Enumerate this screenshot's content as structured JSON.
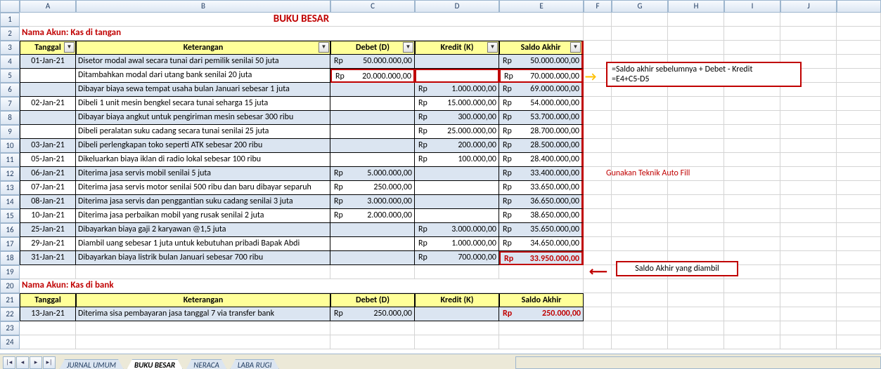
{
  "columns": [
    "A",
    "B",
    "C",
    "D",
    "E",
    "F",
    "G",
    "H",
    "I",
    "J"
  ],
  "title": "BUKU BESAR",
  "akun1": "Nama Akun: Kas di tangan",
  "akun2": "Nama Akun: Kas di bank",
  "headers": {
    "tanggal": "Tanggal",
    "keterangan": "Keterangan",
    "debet": "Debet (D)",
    "kredit": "Kredit (K)",
    "saldo": "Saldo Akhir"
  },
  "rows1": [
    {
      "r": 4,
      "tgl": "01-Jan-21",
      "ket": "Disetor modal awal secara tunai dari pemilik senilai 50 juta",
      "deb": "50.000.000,00",
      "kre": "",
      "sal": "50.000.000,00",
      "alt": true
    },
    {
      "r": 5,
      "tgl": "",
      "ket": "Ditambahkan modal dari utang bank senilai 20 juta",
      "deb": "20.000.000,00",
      "kre": "",
      "sal": "70.000.000,00",
      "alt": false,
      "hi_deb": true,
      "hi_kre": true,
      "hi_sal": true
    },
    {
      "r": 6,
      "tgl": "",
      "ket": "Dibayar biaya sewa tempat usaha bulan Januari sebesar 1 juta",
      "deb": "",
      "kre": "1.000.000,00",
      "sal": "69.000.000,00",
      "alt": true
    },
    {
      "r": 7,
      "tgl": "02-Jan-21",
      "ket": "Dibeli 1 unit mesin bengkel secara tunai seharga 15 juta",
      "deb": "",
      "kre": "15.000.000,00",
      "sal": "54.000.000,00",
      "alt": false
    },
    {
      "r": 8,
      "tgl": "",
      "ket": "Dibayar biaya angkut untuk pengiriman mesin sebesar 300 ribu",
      "deb": "",
      "kre": "300.000,00",
      "sal": "53.700.000,00",
      "alt": true
    },
    {
      "r": 9,
      "tgl": "",
      "ket": "Dibeli peralatan suku cadang secara tunai senilai 25 juta",
      "deb": "",
      "kre": "25.000.000,00",
      "sal": "28.700.000,00",
      "alt": false
    },
    {
      "r": 10,
      "tgl": "03-Jan-21",
      "ket": "Dibeli perlengkapan toko seperti ATK sebesar 200 ribu",
      "deb": "",
      "kre": "200.000,00",
      "sal": "28.500.000,00",
      "alt": true
    },
    {
      "r": 11,
      "tgl": "05-Jan-21",
      "ket": "Dikeluarkan biaya iklan di radio lokal sebesar 100 ribu",
      "deb": "",
      "kre": "100.000,00",
      "sal": "28.400.000,00",
      "alt": false
    },
    {
      "r": 12,
      "tgl": "06-Jan-21",
      "ket": "Diterima jasa servis mobil senilai 5 juta",
      "deb": "5.000.000,00",
      "kre": "",
      "sal": "33.400.000,00",
      "alt": true
    },
    {
      "r": 13,
      "tgl": "07-Jan-21",
      "ket": "Diterima jasa servis motor senilai 500 ribu dan baru dibayar separuh",
      "deb": "250.000,00",
      "kre": "",
      "sal": "33.650.000,00",
      "alt": false
    },
    {
      "r": 14,
      "tgl": "08-Jan-21",
      "ket": "Diterima jasa servis dan penggantian suku cadang senilai 3 juta",
      "deb": "3.000.000,00",
      "kre": "",
      "sal": "36.650.000,00",
      "alt": true
    },
    {
      "r": 15,
      "tgl": "10-Jan-21",
      "ket": "Diterima jasa perbaikan mobil yang rusak senilai 2 juta",
      "deb": "2.000.000,00",
      "kre": "",
      "sal": "38.650.000,00",
      "alt": false
    },
    {
      "r": 16,
      "tgl": "25-Jan-21",
      "ket": "Dibayarkan biaya gaji 2 karyawan @1,5 juta",
      "deb": "",
      "kre": "3.000.000,00",
      "sal": "35.650.000,00",
      "alt": true
    },
    {
      "r": 17,
      "tgl": "29-Jan-21",
      "ket": "Diambil uang sebesar 1 juta untuk kebutuhan pribadi Bapak Abdi",
      "deb": "",
      "kre": "1.000.000,00",
      "sal": "34.650.000,00",
      "alt": false
    },
    {
      "r": 18,
      "tgl": "31-Jan-21",
      "ket": "Dibayarkan biaya listrik bulan Januari sebesar 700 ribu",
      "deb": "",
      "kre": "700.000,00",
      "sal": "33.950.000,00",
      "alt": true,
      "redSal": true,
      "hi_sal_final": true
    }
  ],
  "rows2": [
    {
      "r": 22,
      "tgl": "13-Jan-21",
      "ket": "Diterima sisa pembayaran jasa tanggal 7 via transfer bank",
      "deb": "250.000,00",
      "kre": "",
      "sal": "250.000,00",
      "alt": true,
      "redSal": true
    }
  ],
  "note_formula1": "=Saldo akhir sebelumnya + Debet - Kredit",
  "note_formula2": "=E4+C5-D5",
  "note_autofill": "Gunakan Teknik Auto Fill",
  "note_final": "Saldo Akhir yang diambil",
  "tabs": [
    "JURNAL UMUM",
    "BUKU BESAR",
    "NERACA",
    "LABA RUGI"
  ]
}
